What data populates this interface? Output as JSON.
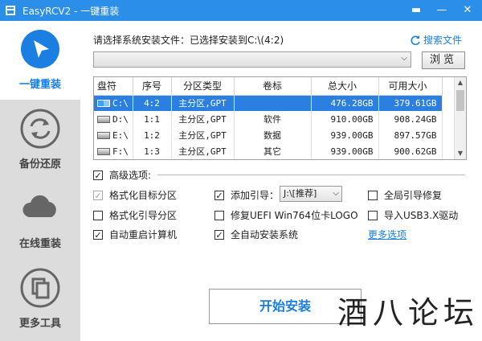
{
  "window": {
    "title": "EasyRCV2 - 一键重装",
    "accent": "#2b8ee8"
  },
  "titlebar": {
    "menu_glyph": "▬",
    "minimize_glyph": "—",
    "close_glyph": "✕"
  },
  "sidebar": {
    "items": [
      {
        "label": "一键重装",
        "icon": "cursor-arrow-icon"
      },
      {
        "label": "备份还原",
        "icon": "refresh-icon"
      },
      {
        "label": "在线重装",
        "icon": "cloud-icon"
      },
      {
        "label": "更多工具",
        "icon": "copy-icon"
      }
    ]
  },
  "file": {
    "prompt": "请选择系统安装文件：已选择安装到C:\\(4:2)",
    "search_label": "搜索文件",
    "selected_value": "",
    "browse_label": "浏览"
  },
  "partitions": {
    "headers": [
      "盘符",
      "序号",
      "分区类型",
      "卷标",
      "总大小",
      "可用大小"
    ],
    "rows": [
      {
        "disk": "C:\\",
        "no": "4:2",
        "type": "主分区,GPT",
        "label": "",
        "total": "476.28GB",
        "free": "379.61GB",
        "selected": true
      },
      {
        "disk": "D:\\",
        "no": "1:1",
        "type": "主分区,GPT",
        "label": "软件",
        "total": "910.00GB",
        "free": "908.24GB",
        "selected": false
      },
      {
        "disk": "E:\\",
        "no": "1:2",
        "type": "主分区,GPT",
        "label": "数据",
        "total": "939.00GB",
        "free": "897.57GB",
        "selected": false
      },
      {
        "disk": "F:\\",
        "no": "1:3",
        "type": "主分区,GPT",
        "label": "其它",
        "total": "939.00GB",
        "free": "900.62GB",
        "selected": false
      }
    ]
  },
  "advanced": {
    "label": "高级选项:",
    "checked": true,
    "options": {
      "format_target": {
        "label": "格式化目标分区",
        "checked": true,
        "disabled": true
      },
      "format_boot": {
        "label": "格式化引导分区",
        "checked": false
      },
      "auto_restart": {
        "label": "自动重启计算机",
        "checked": true
      },
      "add_boot": {
        "label": "添加引导：",
        "checked": true,
        "select_value": "J:\\[推荐]"
      },
      "uefi_fix": {
        "label": "修复UEFI Win764位卡LOGO",
        "checked": false
      },
      "auto_install": {
        "label": "全自动安装系统",
        "checked": true
      },
      "global_boot_fix": {
        "label": "全局引导修复",
        "checked": false
      },
      "usb3_driver": {
        "label": "导入USB3.X驱动",
        "checked": false
      }
    },
    "more_link": "更多选项"
  },
  "start_button": "开始安装",
  "watermark": "酒八论坛"
}
